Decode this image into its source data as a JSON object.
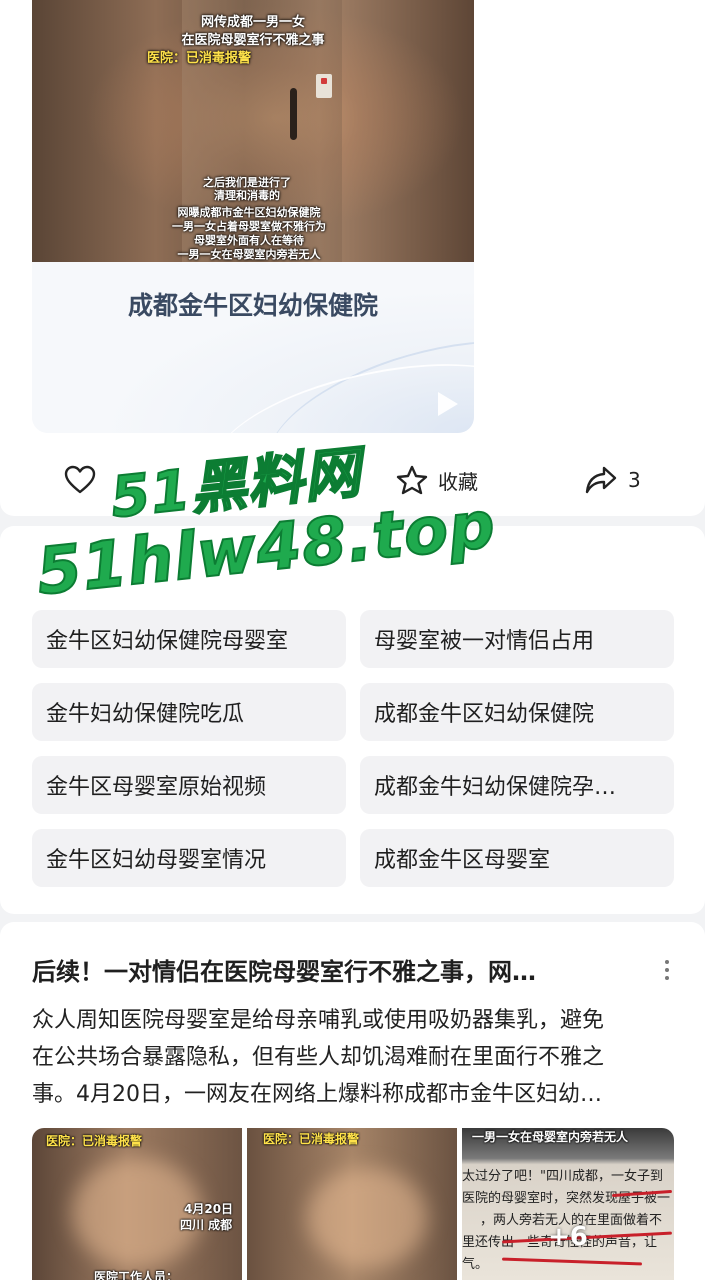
{
  "video": {
    "overlay_title_1": "网传成都一男一女",
    "overlay_title_2": "在医院母婴室行不雅之事",
    "overlay_title_3": "医院：已消毒报警",
    "subtitle_1": "之后我们是进行了",
    "subtitle_2": "清理和消毒的",
    "subtitle_3": "网曝成都市金牛区妇幼保健院",
    "subtitle_4": "一男一女占着母婴室做不雅行为",
    "subtitle_5": "母婴室外面有人在等待",
    "subtitle_6": "一男一女在母婴室内旁若无人",
    "caption": "成都金牛区妇幼保健院"
  },
  "actions": {
    "favorite_label": "收藏",
    "share_count": "3"
  },
  "watermark": {
    "line1": "51黑料网",
    "line2": "51hlw48.top"
  },
  "related_searches": [
    "金牛区妇幼保健院母婴室",
    "母婴室被一对情侣占用",
    "金牛妇幼保健院吃瓜",
    "成都金牛区妇幼保健院",
    "金牛区母婴室原始视频",
    "成都金牛妇幼保健院孕…",
    "金牛区妇幼母婴室情况",
    "成都金牛区母婴室"
  ],
  "article": {
    "title": "后续！一对情侣在医院母婴室行不雅之事，网…",
    "body_line1": "众人周知医院母婴室是给母亲哺乳或使用吸奶器集乳，避免",
    "body_line2": "在公共场合暴露隐私，但有些人却饥渴难耐在里面行不雅之",
    "body_line3": "事。4月20日，一网友在网络上爆料称成都市金牛区妇幼…",
    "thumb1_label_top": "医院：已消毒报警",
    "thumb1_label_date": "4月20日",
    "thumb1_label_city": "四川 成都",
    "thumb1_label_bottom": "医院工作人员：",
    "thumb2_label_top": "医院：已消毒报警",
    "thumb3_header": "一男一女在母婴室内旁若无人",
    "thumb3_line1": "太过分了吧！\"四川成都，一女子到",
    "thumb3_line2": "医院的母婴室时，突然发现屋子被一",
    "thumb3_line3": "，两人旁若无人的在里面做着不",
    "thumb3_line4": "里还传出一些奇奇怪怪的声音，让",
    "thumb3_line5": "气。",
    "more_images": "+6"
  }
}
